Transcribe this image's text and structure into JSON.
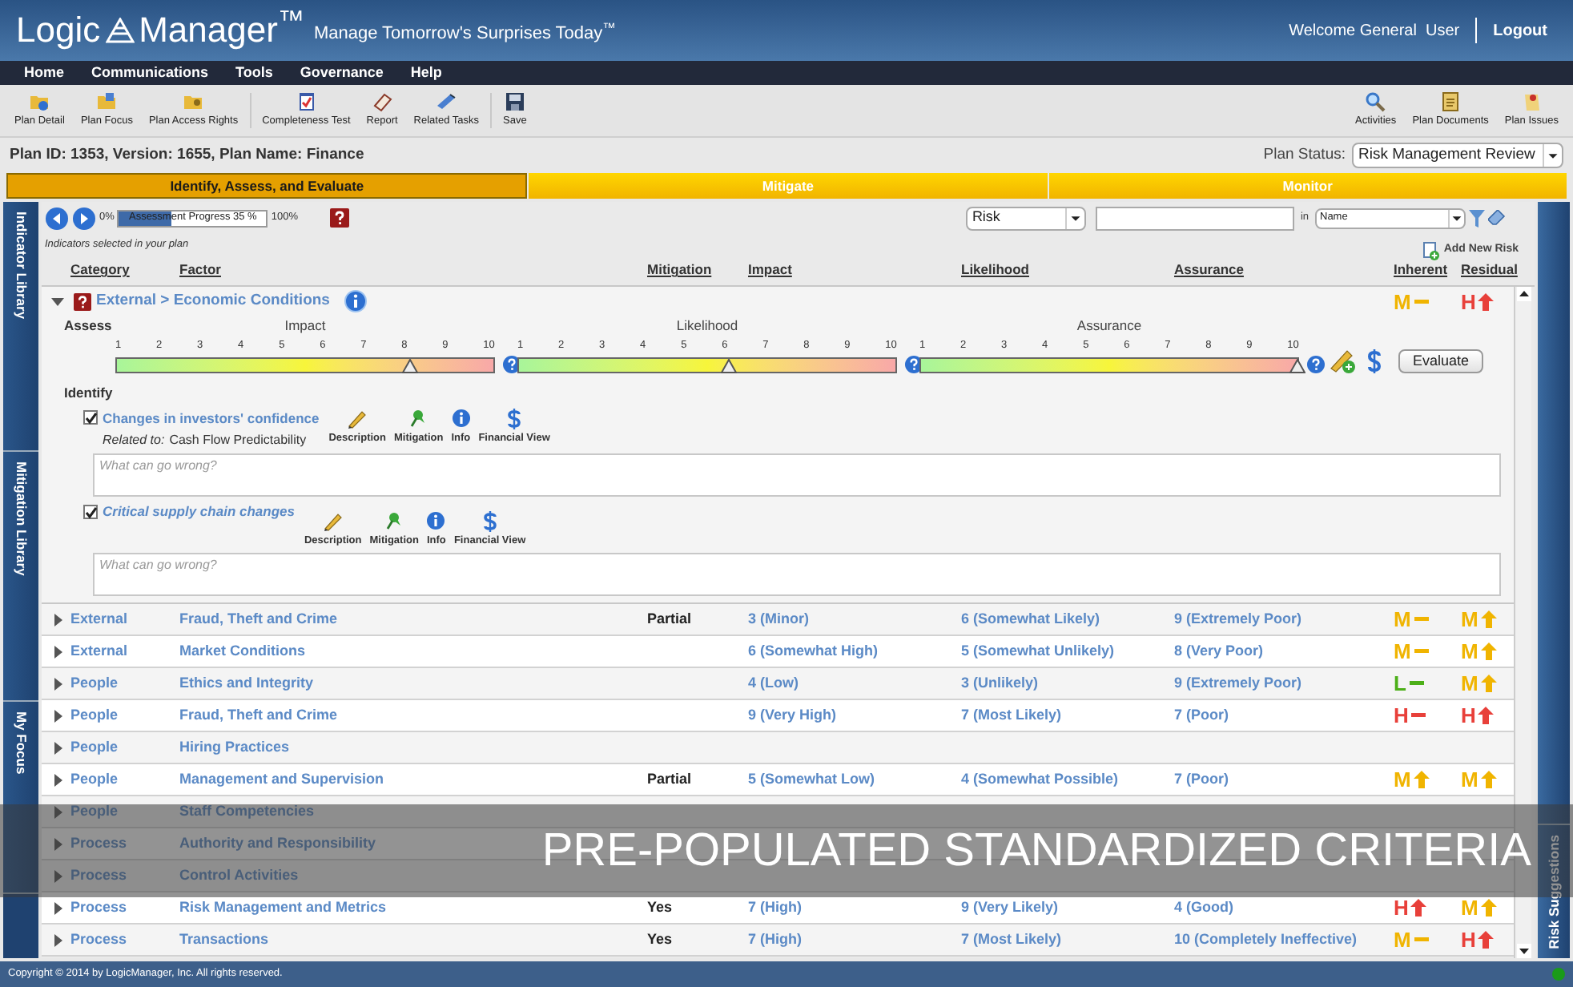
{
  "header": {
    "logo_left": "Logic",
    "logo_right": "Manager$^{™}$",
    "tagline": "Manage Tomorrow's Surprises Today$^{™}$",
    "welcome": "Welcome General  User",
    "logout": "Logout"
  },
  "menu": [
    "Home",
    "Communications",
    "Tools",
    "Governance",
    "Help"
  ],
  "toolbar": {
    "groups": [
      [
        "Plan Detail",
        "Plan Focus",
        "Plan Access Rights"
      ],
      [
        "Completeness Test",
        "Report",
        "Related Tasks"
      ],
      [
        "Save"
      ]
    ],
    "right": [
      "Activities",
      "Plan Documents",
      "Plan Issues"
    ]
  },
  "plan_info": "Plan ID: 1353, Version: 1655, Plan Name: Finance",
  "plan_status": {
    "label": "Plan Status:",
    "value": "Risk Management Review"
  },
  "stages": [
    {
      "label": "Identify, Assess, and Evaluate",
      "selected": true
    },
    {
      "label": "Mitigate",
      "selected": false
    },
    {
      "label": "Monitor",
      "selected": false
    }
  ],
  "side_tabs": [
    "Indicator Library",
    "Mitigation Library",
    "My Focus"
  ],
  "right_tab": "Risk Suggestions",
  "progress": {
    "start": "0%",
    "label": "Assessment Progress 35 %",
    "level": 0.35,
    "end": "100%"
  },
  "subtitle": "Indicators selected in your plan",
  "filter": {
    "type": "Risk",
    "in": "in",
    "field": "Name"
  },
  "add_new": "Add New Risk",
  "columns": [
    "Category",
    "Factor",
    "Mitigation",
    "Impact",
    "Likelihood",
    "Assurance",
    "Inherent",
    "Residual"
  ],
  "rows": [
    {
      "expanded": true,
      "title": "External > Economic Conditions",
      "inherent": {
        "letter": "M",
        "kind": "flat",
        "color": "#f0b400"
      },
      "residual": {
        "letter": "H",
        "kind": "up",
        "color": "#e8403a"
      },
      "detail": {
        "assess_label": "Assess",
        "scales": [
          {
            "name": "Impact",
            "ticks": [
              "1",
              "2",
              "3",
              "4",
              "5",
              "6",
              "7",
              "8",
              "9",
              "10"
            ],
            "level": 0.778
          },
          {
            "name": "Likelihood",
            "ticks": [
              "1",
              "2",
              "3",
              "4",
              "5",
              "6",
              "7",
              "8",
              "9",
              "10"
            ],
            "level": 0.556
          },
          {
            "name": "Assurance",
            "ticks": [
              "1",
              "2",
              "3",
              "4",
              "5",
              "6",
              "7",
              "8",
              "9",
              "10"
            ],
            "level": 1
          }
        ],
        "evaluate": "Evaluate",
        "identify_label": "Identify",
        "indicators": [
          {
            "label": "Changes in investors' confidence",
            "checked": true,
            "italic": false,
            "related_label": "Related to:",
            "related": "Cash Flow Predictability",
            "actions": [
              "Description",
              "Mitigation",
              "Info",
              "Financial View"
            ],
            "placeholder": "What can go wrong?"
          },
          {
            "label": "Critical supply chain changes",
            "checked": true,
            "italic": true,
            "actions": [
              "Description",
              "Mitigation",
              "Info",
              "Financial View"
            ],
            "placeholder": "What can go wrong?"
          }
        ]
      }
    },
    {
      "expanded": false,
      "category": "External",
      "factor": "Fraud, Theft and Crime",
      "mitigation": "Partial",
      "impact": "3 (Minor)",
      "likelihood": "6 (Somewhat Likely)",
      "assurance": "9 (Extremely Poor)",
      "inherent": {
        "letter": "M",
        "kind": "flat",
        "color": "#f0b400"
      },
      "residual": {
        "letter": "M",
        "kind": "up",
        "color": "#f0b400"
      }
    },
    {
      "expanded": false,
      "category": "External",
      "factor": "Market Conditions",
      "impact": "6 (Somewhat High)",
      "likelihood": "5 (Somewhat Unlikely)",
      "assurance": "8 (Very Poor)",
      "inherent": {
        "letter": "M",
        "kind": "flat",
        "color": "#f0b400"
      },
      "residual": {
        "letter": "M",
        "kind": "up",
        "color": "#f0b400"
      }
    },
    {
      "expanded": false,
      "category": "People",
      "factor": "Ethics and Integrity",
      "impact": "4 (Low)",
      "likelihood": "3 (Unlikely)",
      "assurance": "9 (Extremely Poor)",
      "inherent": {
        "letter": "L",
        "kind": "flat",
        "color": "#4caf18"
      },
      "residual": {
        "letter": "M",
        "kind": "up",
        "color": "#f0b400"
      }
    },
    {
      "expanded": false,
      "category": "People",
      "factor": "Fraud, Theft and Crime",
      "impact": "9 (Very High)",
      "likelihood": "7 (Most Likely)",
      "assurance": "7 (Poor)",
      "inherent": {
        "letter": "H",
        "kind": "flat",
        "color": "#e8403a"
      },
      "residual": {
        "letter": "H",
        "kind": "up",
        "color": "#e8403a"
      }
    },
    {
      "expanded": false,
      "category": "People",
      "factor": "Hiring Practices"
    },
    {
      "expanded": false,
      "category": "People",
      "factor": "Management and Supervision",
      "mitigation": "Partial",
      "impact": "5 (Somewhat Low)",
      "likelihood": "4 (Somewhat Possible)",
      "assurance": "7 (Poor)",
      "inherent": {
        "letter": "M",
        "kind": "up",
        "color": "#f0b400"
      },
      "residual": {
        "letter": "M",
        "kind": "up",
        "color": "#f0b400"
      }
    },
    {
      "expanded": false,
      "category": "People",
      "factor": "Staff Competencies"
    },
    {
      "expanded": false,
      "category": "Process",
      "factor": "Authority and Responsibility"
    },
    {
      "expanded": false,
      "category": "Process",
      "factor": "Control Activities"
    },
    {
      "expanded": false,
      "category": "Process",
      "factor": "Risk Management and Metrics",
      "mitigation": "Yes",
      "impact": "7 (High)",
      "likelihood": "9 (Very Likely)",
      "assurance": "4 (Good)",
      "inherent": {
        "letter": "H",
        "kind": "up",
        "color": "#e8403a"
      },
      "residual": {
        "letter": "M",
        "kind": "up",
        "color": "#f0b400"
      }
    },
    {
      "expanded": false,
      "category": "Process",
      "factor": "Transactions",
      "mitigation": "Yes",
      "impact": "7 (High)",
      "likelihood": "7 (Most Likely)",
      "assurance": "10 (Completely Ineffective)",
      "inherent": {
        "letter": "M",
        "kind": "flat",
        "color": "#f0b400"
      },
      "residual": {
        "letter": "H",
        "kind": "up",
        "color": "#e8403a"
      }
    }
  ],
  "banner": "PRE-POPULATED STANDARDIZED CRITERIA",
  "footer": "Copyright © 2014 by LogicManager, Inc. All rights reserved."
}
